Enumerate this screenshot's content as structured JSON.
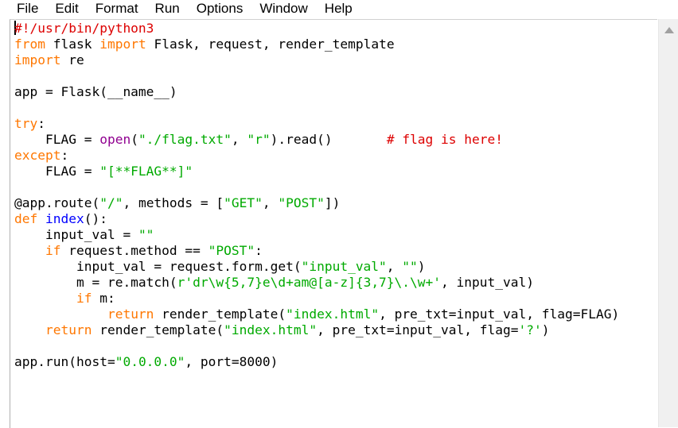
{
  "menu": {
    "items": [
      "File",
      "Edit",
      "Format",
      "Run",
      "Options",
      "Window",
      "Help"
    ]
  },
  "code": {
    "lines": [
      [
        {
          "t": "#!/usr/bin/python3",
          "c": "com"
        }
      ],
      [
        {
          "t": "from",
          "c": "kw"
        },
        {
          "t": " flask ",
          "c": ""
        },
        {
          "t": "import",
          "c": "kw"
        },
        {
          "t": " Flask, request, render_template",
          "c": ""
        }
      ],
      [
        {
          "t": "import",
          "c": "kw"
        },
        {
          "t": " re",
          "c": ""
        }
      ],
      [],
      [
        {
          "t": "app = Flask(__name__)",
          "c": ""
        }
      ],
      [],
      [
        {
          "t": "try",
          "c": "kw"
        },
        {
          "t": ":",
          "c": ""
        }
      ],
      [
        {
          "t": "    FLAG = ",
          "c": ""
        },
        {
          "t": "open",
          "c": "bi"
        },
        {
          "t": "(",
          "c": ""
        },
        {
          "t": "\"./flag.txt\"",
          "c": "str"
        },
        {
          "t": ", ",
          "c": ""
        },
        {
          "t": "\"r\"",
          "c": "str"
        },
        {
          "t": ").read()       ",
          "c": ""
        },
        {
          "t": "# flag is here!",
          "c": "com"
        }
      ],
      [
        {
          "t": "except",
          "c": "kw"
        },
        {
          "t": ":",
          "c": ""
        }
      ],
      [
        {
          "t": "    FLAG = ",
          "c": ""
        },
        {
          "t": "\"[**FLAG**]\"",
          "c": "str"
        }
      ],
      [],
      [
        {
          "t": "@app.route(",
          "c": ""
        },
        {
          "t": "\"/\"",
          "c": "str"
        },
        {
          "t": ", methods = [",
          "c": ""
        },
        {
          "t": "\"GET\"",
          "c": "str"
        },
        {
          "t": ", ",
          "c": ""
        },
        {
          "t": "\"POST\"",
          "c": "str"
        },
        {
          "t": "])",
          "c": ""
        }
      ],
      [
        {
          "t": "def",
          "c": "kw"
        },
        {
          "t": " ",
          "c": ""
        },
        {
          "t": "index",
          "c": "def"
        },
        {
          "t": "():",
          "c": ""
        }
      ],
      [
        {
          "t": "    input_val = ",
          "c": ""
        },
        {
          "t": "\"\"",
          "c": "str"
        }
      ],
      [
        {
          "t": "    ",
          "c": ""
        },
        {
          "t": "if",
          "c": "kw"
        },
        {
          "t": " request.method == ",
          "c": ""
        },
        {
          "t": "\"POST\"",
          "c": "str"
        },
        {
          "t": ":",
          "c": ""
        }
      ],
      [
        {
          "t": "        input_val = request.form.get(",
          "c": ""
        },
        {
          "t": "\"input_val\"",
          "c": "str"
        },
        {
          "t": ", ",
          "c": ""
        },
        {
          "t": "\"\"",
          "c": "str"
        },
        {
          "t": ")",
          "c": ""
        }
      ],
      [
        {
          "t": "        m = re.match(",
          "c": ""
        },
        {
          "t": "r'dr\\w{5,7}e\\d+am@[a-z]{3,7}\\.\\w+'",
          "c": "str"
        },
        {
          "t": ", input_val)",
          "c": ""
        }
      ],
      [
        {
          "t": "        ",
          "c": ""
        },
        {
          "t": "if",
          "c": "kw"
        },
        {
          "t": " m:",
          "c": ""
        }
      ],
      [
        {
          "t": "            ",
          "c": ""
        },
        {
          "t": "return",
          "c": "kw"
        },
        {
          "t": " render_template(",
          "c": ""
        },
        {
          "t": "\"index.html\"",
          "c": "str"
        },
        {
          "t": ", pre_txt=input_val, flag=FLAG)",
          "c": ""
        }
      ],
      [
        {
          "t": "    ",
          "c": ""
        },
        {
          "t": "return",
          "c": "kw"
        },
        {
          "t": " render_template(",
          "c": ""
        },
        {
          "t": "\"index.html\"",
          "c": "str"
        },
        {
          "t": ", pre_txt=input_val, flag=",
          "c": ""
        },
        {
          "t": "'?'",
          "c": "str"
        },
        {
          "t": ")",
          "c": ""
        }
      ],
      [],
      [
        {
          "t": "app.run(host=",
          "c": ""
        },
        {
          "t": "\"0.0.0.0\"",
          "c": "str"
        },
        {
          "t": ", port=8000)",
          "c": ""
        }
      ]
    ]
  }
}
